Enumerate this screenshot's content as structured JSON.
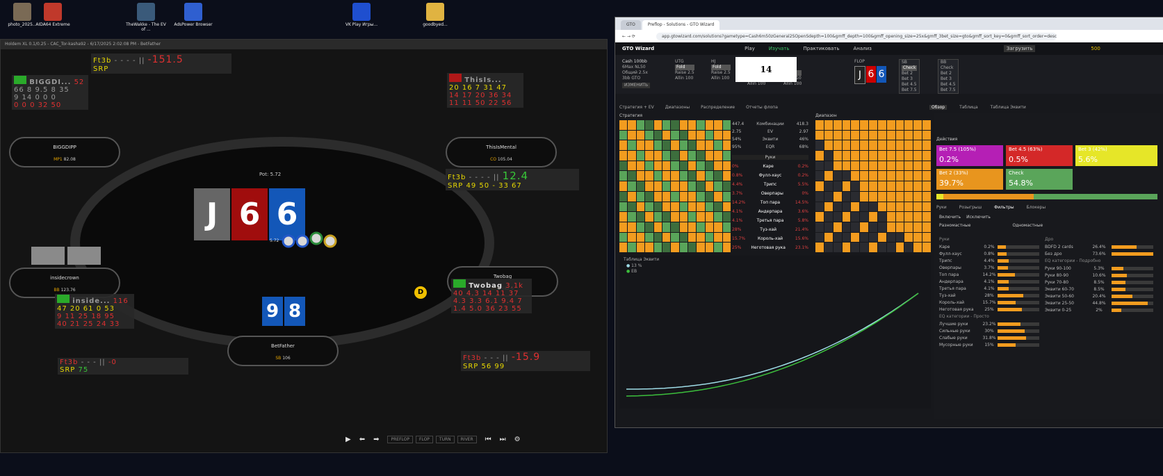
{
  "desktop": {
    "icons": [
      {
        "label": "photo_2025...",
        "color": "#7a6a55"
      },
      {
        "label": "AIDA64 Extreme",
        "color": "#c0392b"
      },
      {
        "label": "TheWakke - The EV of ...",
        "color": "#3a5a7a"
      },
      {
        "label": "AdsPower Browser",
        "color": "#2f5fd0"
      },
      {
        "label": "VK Play Игры...",
        "color": "#1f4fcf"
      },
      {
        "label": "goodbyed...",
        "color": "#e0b341"
      }
    ]
  },
  "poker": {
    "title": "Holdem XL 0.1/0.25 - CAC_Tor-kasha92 - 6/17/2025 2:02:08 PM - BetFather",
    "pot_label": "Pot: 5.72",
    "board": [
      {
        "rank": "J",
        "color": "#666666"
      },
      {
        "rank": "6",
        "color": "#a00d0d"
      },
      {
        "rank": "6",
        "color": "#1357b8"
      }
    ],
    "hero_cards": [
      "9",
      "8"
    ],
    "bet_amount": "5.72",
    "dealer": "D",
    "seats": [
      {
        "name": "BIGGDIPP",
        "prefix": "MP1",
        "stack": "82.08"
      },
      {
        "name": "ThisIsMental",
        "prefix": "CO",
        "stack": "105.04"
      },
      {
        "name": "insidecrown",
        "prefix": "BB",
        "stack": "123.76"
      },
      {
        "name": "Twobag",
        "prefix": "BTN",
        "stack": "182.6"
      },
      {
        "name": "BetFather",
        "prefix": "SB",
        "stack": "106"
      }
    ],
    "huds": {
      "top_center": {
        "l1": "Ft3b",
        "v1": "-151.5",
        "l2": "SRP"
      },
      "biggdi": {
        "name": "BIGGDI...",
        "num": "52",
        "rows": [
          "66 8 9.5 8 35",
          "9 14 0 0 0",
          "0 0 0 32 50"
        ]
      },
      "thisis": {
        "name": "ThisIs...",
        "rows": [
          "20 16 7 31 47",
          "14 17 20 36 34",
          "11 11 50 22 56"
        ]
      },
      "right_mid": {
        "l1": "Ft3b",
        "v1": "12.4",
        "l2": "SRP",
        "v2": "49 50 - 33 67"
      },
      "inside": {
        "name": "inside...",
        "num": "116",
        "rows": [
          "47 20 61 0 53",
          "9 11 25 18 95",
          "40 21 25 24 33"
        ]
      },
      "twobag": {
        "name": "Twobag",
        "num": "3.1k",
        "rows": [
          "40 4.3 14 11 37",
          "4.3 3.3 6.1 9.4 7",
          "1.4 5.0 36 23 55"
        ]
      },
      "left_bot": {
        "l1": "Ft3b",
        "v1": "-0",
        "l2": "SRP",
        "v2": "75"
      },
      "right_bot": {
        "l1": "Ft3b",
        "v1": "-15.9",
        "l2": "SRP",
        "v2": "56 99"
      }
    },
    "controls": [
      "PREFLOP",
      "FLOP",
      "TURN",
      "RIVER"
    ]
  },
  "browser": {
    "tabs": [
      {
        "label": "GTO"
      },
      {
        "label": "Preflop - Solutions - GTO Wizard"
      }
    ],
    "url": "app.gtowizard.com/solutions?gametype=Cash6m50zGeneral2SOpenSdepth=100&gmff_depth=100&gmff_opening_size=25x&gmff_3bet_size=gto&gmff_sort_key=0&gmff_sort_order=desc",
    "app": {
      "logo": "GTO Wizard",
      "nav": [
        "Play",
        "Изучать",
        "Практиковать",
        "Анализ"
      ],
      "upload": "Загрузить",
      "balance": "500"
    },
    "config": {
      "game": "Cash 100bb",
      "lines": [
        "6Max NL50",
        "Общий 2.5x",
        "3bb GTO"
      ],
      "edit": "ИЗМЕНИТЬ"
    },
    "overlay_number": "14",
    "flop_label": "FLOP",
    "flop_cards": [
      "J",
      "6",
      "6"
    ],
    "action_cols": [
      {
        "hdr": "UTG",
        "items": [
          "Fold",
          "Raise 2.5",
          "Allin 100"
        ],
        "sel": 0
      },
      {
        "hdr": "HJ",
        "items": [
          "Fold",
          "Raise 2.5",
          "Allin 100"
        ],
        "sel": 0
      },
      {
        "hdr": "BB",
        "items": [
          "Fold",
          "Call",
          "Raise 3",
          "Allin 100"
        ],
        "sel": 2
      },
      {
        "hdr": "SB",
        "items": [
          "Fold",
          "Call",
          "Raise 10",
          "Allin 100"
        ],
        "sel": 1
      },
      {
        "hdr": "SB",
        "items": [
          "Check",
          "Bet 2",
          "Bet 3",
          "Bet 4.5",
          "Bet 7.5"
        ],
        "sel": 0
      },
      {
        "hdr": "BB",
        "items": [
          "Check",
          "Bet 2",
          "Bet 3",
          "Bet 4.5",
          "Bet 7.5"
        ],
        "sel": -1
      }
    ],
    "subtabs": [
      "Стратегия + EV",
      "Диапазоны",
      "Распределение",
      "Отчеты флопа"
    ],
    "right_tabs": [
      "Обзор",
      "Таблица",
      "Таблица Эквити"
    ],
    "strategy_label": "Стратегия",
    "range_label": "Диапазон",
    "stats": [
      {
        "l": "Комбинации",
        "a": "447.4",
        "b": "418.3"
      },
      {
        "l": "EV",
        "a": "2.75",
        "b": "2.97"
      },
      {
        "l": "Эквити",
        "a": "54%",
        "b": "46%"
      },
      {
        "l": "EQR",
        "a": "95%",
        "b": "68%"
      }
    ],
    "hands_header": "Руки",
    "hand_cats": [
      {
        "l": "Каре",
        "a": "0%",
        "b": "0.2%"
      },
      {
        "l": "Фулл-хаус",
        "a": "0.8%",
        "b": "0.2%"
      },
      {
        "l": "Трипс",
        "a": "4.4%",
        "b": "5.5%"
      },
      {
        "l": "Оверпары",
        "a": "3.7%",
        "b": "0%"
      },
      {
        "l": "Топ пара",
        "a": "14.2%",
        "b": "14.5%"
      },
      {
        "l": "Андерпара",
        "a": "4.1%",
        "b": "3.6%"
      },
      {
        "l": "Третья пара",
        "a": "4.1%",
        "b": "5.8%"
      },
      {
        "l": "Туз-хай",
        "a": "28%",
        "b": "21.4%"
      },
      {
        "l": "Король-хай",
        "a": "15.7%",
        "b": "15.6%"
      },
      {
        "l": "Неготовая рука",
        "a": "25%",
        "b": "23.1%"
      }
    ],
    "equity_label": "Таблица Эквити",
    "equity_series": [
      {
        "name": "13 %",
        "color": "#9fdde8"
      },
      {
        "name": "EB",
        "color": "#3cbf3c"
      }
    ],
    "actions_label": "Действия",
    "actions": [
      {
        "label": "Bet 7.5 (105%)",
        "pct": "0.2%",
        "color": "#b51fb5"
      },
      {
        "label": "Bet 4.5 (63%)",
        "pct": "0.5%",
        "color": "#d42828"
      },
      {
        "label": "Bet 3 (42%)",
        "pct": "5.6%",
        "color": "#e6e628"
      },
      {
        "label": "Bet 2 (33%)",
        "pct": "39.7%",
        "color": "#e8951e"
      },
      {
        "label": "Check",
        "pct": "54.8%",
        "color": "#5aa55a"
      }
    ],
    "lower_tabs": [
      "Руки",
      "Розыгрыш",
      "Фильтры",
      "Блокеры"
    ],
    "filter_labels": [
      "Включить",
      "Исключить"
    ],
    "suit_labels": [
      "Разномастные",
      "Одномастные"
    ],
    "left_filters": [
      {
        "l": "Каре",
        "v": "0.2%"
      },
      {
        "l": "Фулл-хаус",
        "v": "0.8%"
      },
      {
        "l": "Трипс",
        "v": "4.4%"
      },
      {
        "l": "Оверпары",
        "v": "3.7%"
      },
      {
        "l": "Топ пара",
        "v": "14.2%"
      },
      {
        "l": "Андерпара",
        "v": "4.1%"
      },
      {
        "l": "Третья пара",
        "v": "4.1%"
      },
      {
        "l": "Туз-хай",
        "v": "28%"
      },
      {
        "l": "Король-хай",
        "v": "15.7%"
      },
      {
        "l": "Неготовая рука",
        "v": "25%"
      }
    ],
    "left_filters_hdr": "Руки",
    "eq_cats_hdr": "EQ категории - Просто",
    "eq_cats": [
      {
        "l": "Лучшие руки",
        "v": "23.2%"
      },
      {
        "l": "Сильные руки",
        "v": "30%"
      },
      {
        "l": "Слабые руки",
        "v": "31.8%"
      },
      {
        "l": "Мусорные руки",
        "v": "15%"
      }
    ],
    "draws_hdr": "Дро",
    "draws": [
      {
        "l": "BDFD 2 cards",
        "v": "26.4%"
      },
      {
        "l": "Без дро",
        "v": "73.6%"
      }
    ],
    "eq_detail_hdr": "EQ категории - Подробно",
    "eq_detail": [
      {
        "l": "Руки 90-100",
        "v": "5.3%"
      },
      {
        "l": "Руки 80-90",
        "v": "10.6%"
      },
      {
        "l": "Руки 70-80",
        "v": "8.5%"
      },
      {
        "l": "Эквити 60-70",
        "v": "8.5%"
      },
      {
        "l": "Эквити 50-60",
        "v": "20.4%"
      },
      {
        "l": "Эквити 25-50",
        "v": "44.8%"
      },
      {
        "l": "Эквити 0-25",
        "v": "2%"
      }
    ]
  }
}
